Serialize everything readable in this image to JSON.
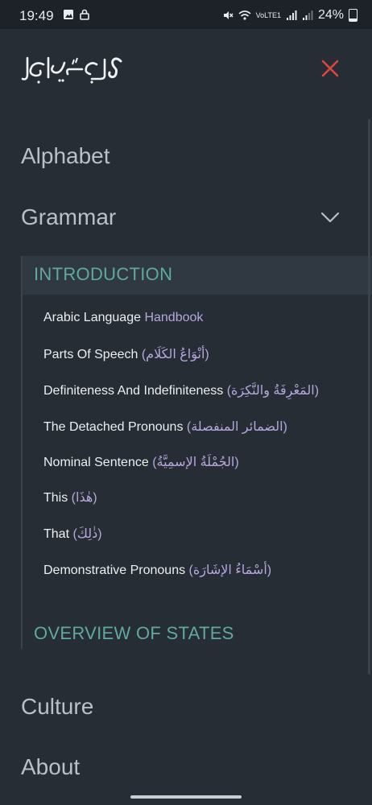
{
  "status_bar": {
    "time": "19:49",
    "network_label": "VoLTE1",
    "battery_percent": "24%",
    "icons": [
      "image-icon",
      "lock-icon",
      "mute-icon",
      "wifi-icon",
      "signal-icon",
      "signal-icon",
      "battery-icon"
    ]
  },
  "header": {
    "logo_text": "وقل رب زدني علما",
    "close_color": "#e0453d"
  },
  "nav": {
    "alphabet": "Alphabet",
    "grammar": "Grammar",
    "culture": "Culture",
    "about": "About"
  },
  "grammar_menu": {
    "introduction": "INTRODUCTION",
    "overview": "OVERVIEW OF STATES",
    "links": [
      {
        "en": "Arabic Language ",
        "hl": "Handbook",
        "ar": ""
      },
      {
        "en": "Parts Of Speech ",
        "hl": "",
        "ar": "(أنْوَاعُ الكَلَام)"
      },
      {
        "en": "Definiteness And Indefiniteness ",
        "hl": "",
        "ar": "(المَعْرِفَةُ والنَّكِرَة)"
      },
      {
        "en": "The Detached Pronouns ",
        "hl": "",
        "ar": "(الضمائر المنفصلة)"
      },
      {
        "en": "Nominal Sentence ",
        "hl": "",
        "ar": "(الجُمْلَةُ الإسمِيَّةُ)"
      },
      {
        "en": "This ",
        "hl": "",
        "ar": "(هٰذَا)"
      },
      {
        "en": "That ",
        "hl": "",
        "ar": "(ذٰلِكَ)"
      },
      {
        "en": "Demonstrative Pronouns ",
        "hl": "",
        "ar": "(أسْمَاءُ الإشَارَة)"
      }
    ]
  },
  "colors": {
    "background": "#262d34",
    "accent_teal": "#5fa9a1",
    "arabic_purple": "#b6a8e0"
  }
}
